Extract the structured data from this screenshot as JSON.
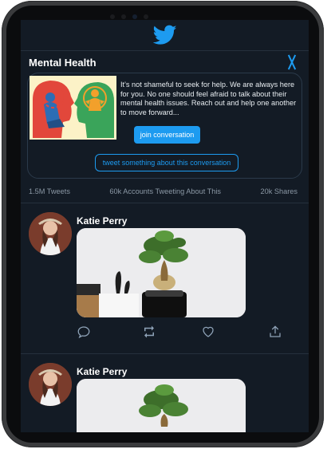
{
  "app": {
    "logo": "twitter-bird-icon",
    "brand_color": "#1d9bf0",
    "background": "#131b25"
  },
  "panel": {
    "title": "Mental Health",
    "close_icon": "close-icon",
    "card": {
      "image": "mental-health-illustration",
      "text": "It's not shameful to seek for help. We are always here for you. No one should feel afraid to talk about their mental health issues. Reach out and help one another to move forward...",
      "join_label": "join conversation",
      "tweet_label": "tweet something about this conversation"
    },
    "stats": {
      "tweets": "1.5M Tweets",
      "accounts": "60k Accounts Tweeting About This",
      "shares": "20k Shares"
    }
  },
  "tweets": [
    {
      "author": "Katie Perry",
      "media": "bonsai-plant-photo",
      "actions": [
        "reply-icon",
        "retweet-icon",
        "like-icon",
        "share-icon"
      ]
    },
    {
      "author": "Katie Perry",
      "media": "bonsai-plant-photo"
    }
  ]
}
